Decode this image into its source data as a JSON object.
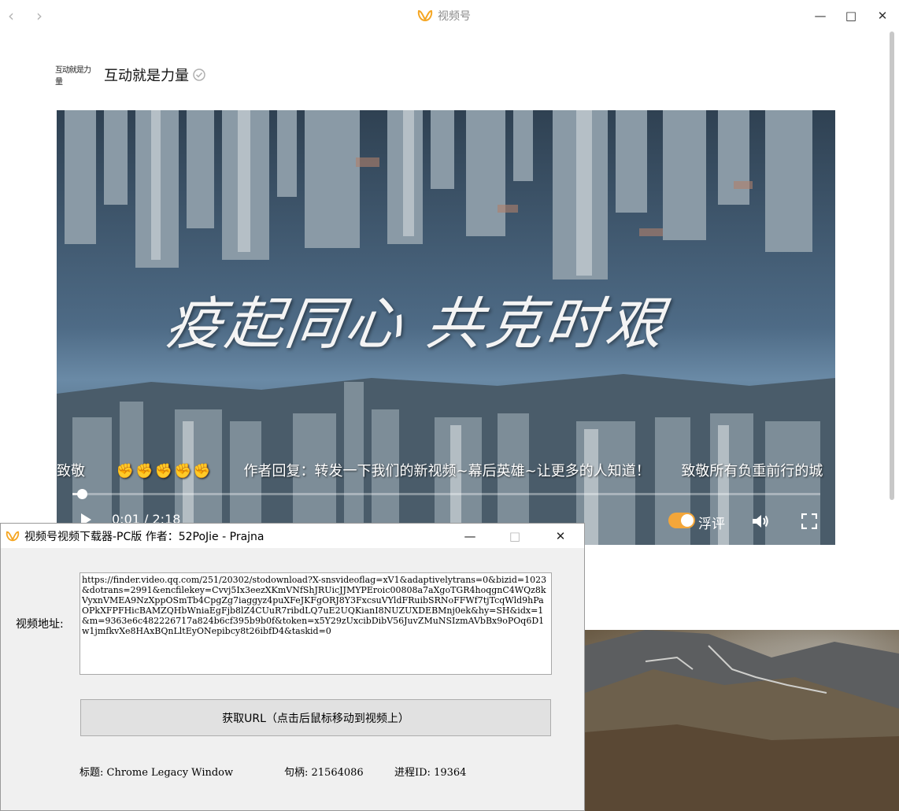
{
  "wechat_window": {
    "nav": {
      "back_icon": "chevron-left-icon",
      "forward_icon": "chevron-right-icon"
    },
    "app_title": "视频号",
    "app_icon_color": "#f5a623",
    "author": {
      "logo_text": "互动就是力量",
      "name": "互动就是力量",
      "verified_icon": "verified-badge-icon"
    },
    "video": {
      "caption_art": "疫起同心 共克时艰",
      "danmaku": [
        "致敬",
        "✊✊✊✊✊",
        "作者回复：转发一下我们的新视频~幕后英雄~让更多的人知道！",
        "致敬所有负重前行的城"
      ],
      "time": "0:01 / 2:18",
      "progress": 0.007,
      "danmaku_toggle_label": "浮评",
      "danmaku_toggle_on": true,
      "accent_color": "#f3a63a"
    }
  },
  "downloader": {
    "title": "视频号视频下载器-PC版   作者：52PoJie - Prajna",
    "url_label": "视频地址:",
    "url_value": "https://finder.video.qq.com/251/20302/stodownload?X-snsvideoflag=xV1&adaptivelytrans=0&bizid=1023&dotrans=2991&encfilekey=Cvvj5Ix3eezXKmVNfShJRUicJJMYPEroic00808a7aXgoTGR4hoqgnC4WQz8kVyxnVMEA9NzXppOSmTb4CpgZg7iaggyz4puXFeJKFgORJ8Y3FxcsuVYldFRuibSRNoFFWf7tjTcqWld9hPaOPkXFPFHicBAMZQHbWniaEgFjb8lZ4CUuR7ribdLQ7uE2UQKianI8NUZUXDEBMnj0ek&hy=SH&idx=1&m=9363e6c482226717a824b6cf395b9b0f&token=x5Y29zUxcibDibV56JuvZMuNSIzmAVbBx9oPOq6D1w1jmfkvXe8HAxBQnLltEyONepibcy8t26ibfD4&taskid=0",
    "fetch_button": "获取URL（点击后鼠标移动到视频上）",
    "info": {
      "title_text": "标题: Chrome Legacy Window",
      "handle_text": "句柄: 21564086",
      "pid_text": "进程ID: 19364"
    }
  }
}
